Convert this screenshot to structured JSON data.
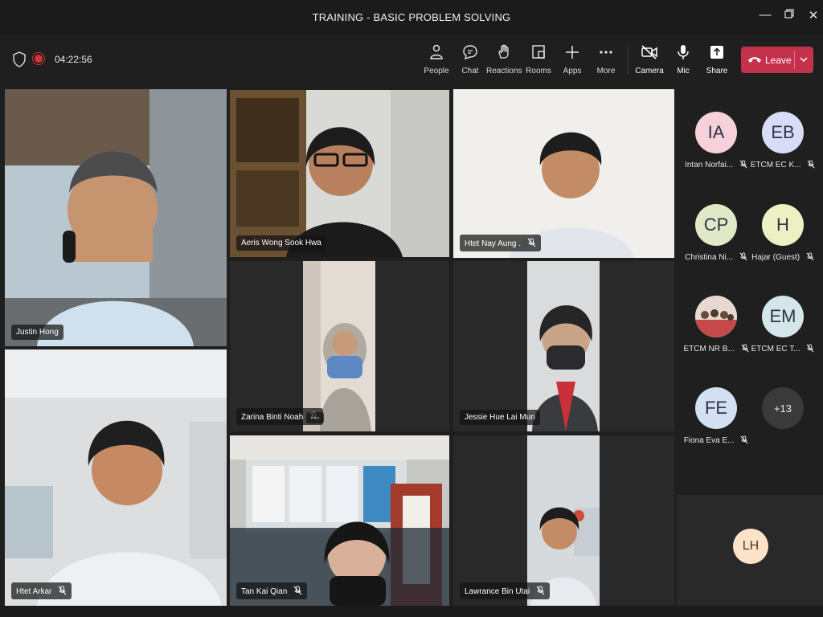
{
  "window": {
    "title": "TRAINING - BASIC PROBLEM SOLVING"
  },
  "meeting": {
    "timer": "04:22:56"
  },
  "toolbar": {
    "people_label": "People",
    "chat_label": "Chat",
    "reactions_label": "Reactions",
    "rooms_label": "Rooms",
    "apps_label": "Apps",
    "more_label": "More",
    "camera_label": "Camera",
    "mic_label": "Mic",
    "share_label": "Share",
    "leave_label": "Leave"
  },
  "tiles": {
    "justin": {
      "name": "Justin Hong"
    },
    "aeris": {
      "name": "Aeris Wong Sook Hwa"
    },
    "htet_nay": {
      "name": "Htet Nay Aung ."
    },
    "zarina": {
      "name": "Zarina Binti Noah"
    },
    "jessie": {
      "name": "Jessie Hue Lai Mun"
    },
    "htet_arkar": {
      "name": "Htet Arkar"
    },
    "tan": {
      "name": "Tan Kai Qian"
    },
    "lawrance": {
      "name": "Lawrance Bin Utai"
    }
  },
  "roster": [
    {
      "initials": "IA",
      "name": "Intan Norfai...",
      "color": "#f6d1d9"
    },
    {
      "initials": "EB",
      "name": "ETCM EC K...",
      "color": "#d9dcf6"
    },
    {
      "initials": "CP",
      "name": "Christina Ni...",
      "color": "#dfe9c6"
    },
    {
      "initials": "H",
      "name": "Hajar (Guest)",
      "color": "#eef0c4"
    },
    {
      "initials": "",
      "name": "ETCM NR B...",
      "color": "#d8c6c6"
    },
    {
      "initials": "EM",
      "name": "ETCM EC T...",
      "color": "#d4e6ea"
    },
    {
      "initials": "FE",
      "name": "Fiona Eva E...",
      "color": "#d2e0f1"
    },
    {
      "initials": "+13",
      "name": "",
      "color": "#3a3a3a"
    }
  ],
  "self": {
    "initials": "LH"
  },
  "colors": {
    "accent": "#7f85f5",
    "leave": "#c4314b",
    "background": "#1f1f1f"
  }
}
